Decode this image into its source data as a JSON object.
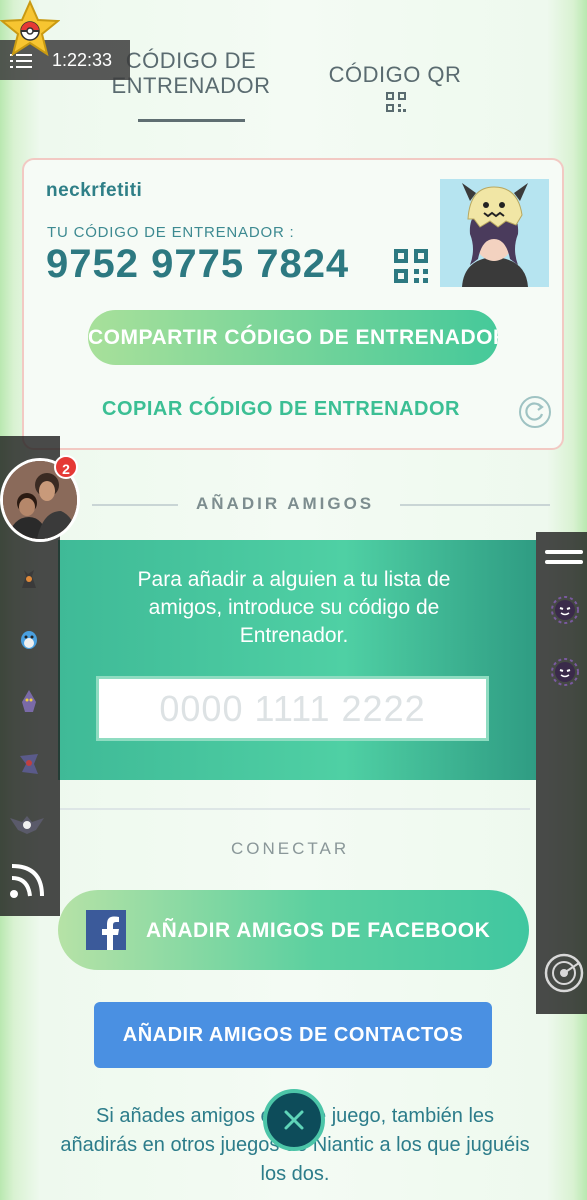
{
  "tabs": [
    {
      "label": "CÓDIGO DE ENTRENADOR",
      "active": true
    },
    {
      "label": "CÓDIGO QR",
      "active": false
    }
  ],
  "trainer": {
    "username": "neckrfetiti",
    "code_label": "TU CÓDIGO DE ENTRENADOR :",
    "code": "9752 9775 7824",
    "share_label": "COMPARTIR CÓDIGO DE ENTRENADOR",
    "copy_label": "COPIAR CÓDIGO DE ENTRENADOR"
  },
  "add_friends": {
    "title": "AÑADIR AMIGOS",
    "instructions": "Para añadir a alguien a tu lista de amigos, introduce su código de Entrenador.",
    "input_placeholder": "0000 1111 2222"
  },
  "connect": {
    "title": "CONECTAR",
    "facebook_label": "AÑADIR AMIGOS DE FACEBOOK",
    "contacts_label": "AÑADIR AMIGOS DE CONTACTOS",
    "footer": "Si añades amigos en este juego, también les añadirás en otros juegos de Niantic a los que juguéis los dos."
  },
  "overlay": {
    "time": "1:22:33",
    "notification_count": "2"
  },
  "colors": {
    "accent_teal": "#2d7981",
    "brand_green": "#3bbf94",
    "facebook_blue": "#3b5a9a",
    "contacts_blue": "#4a90e2"
  }
}
